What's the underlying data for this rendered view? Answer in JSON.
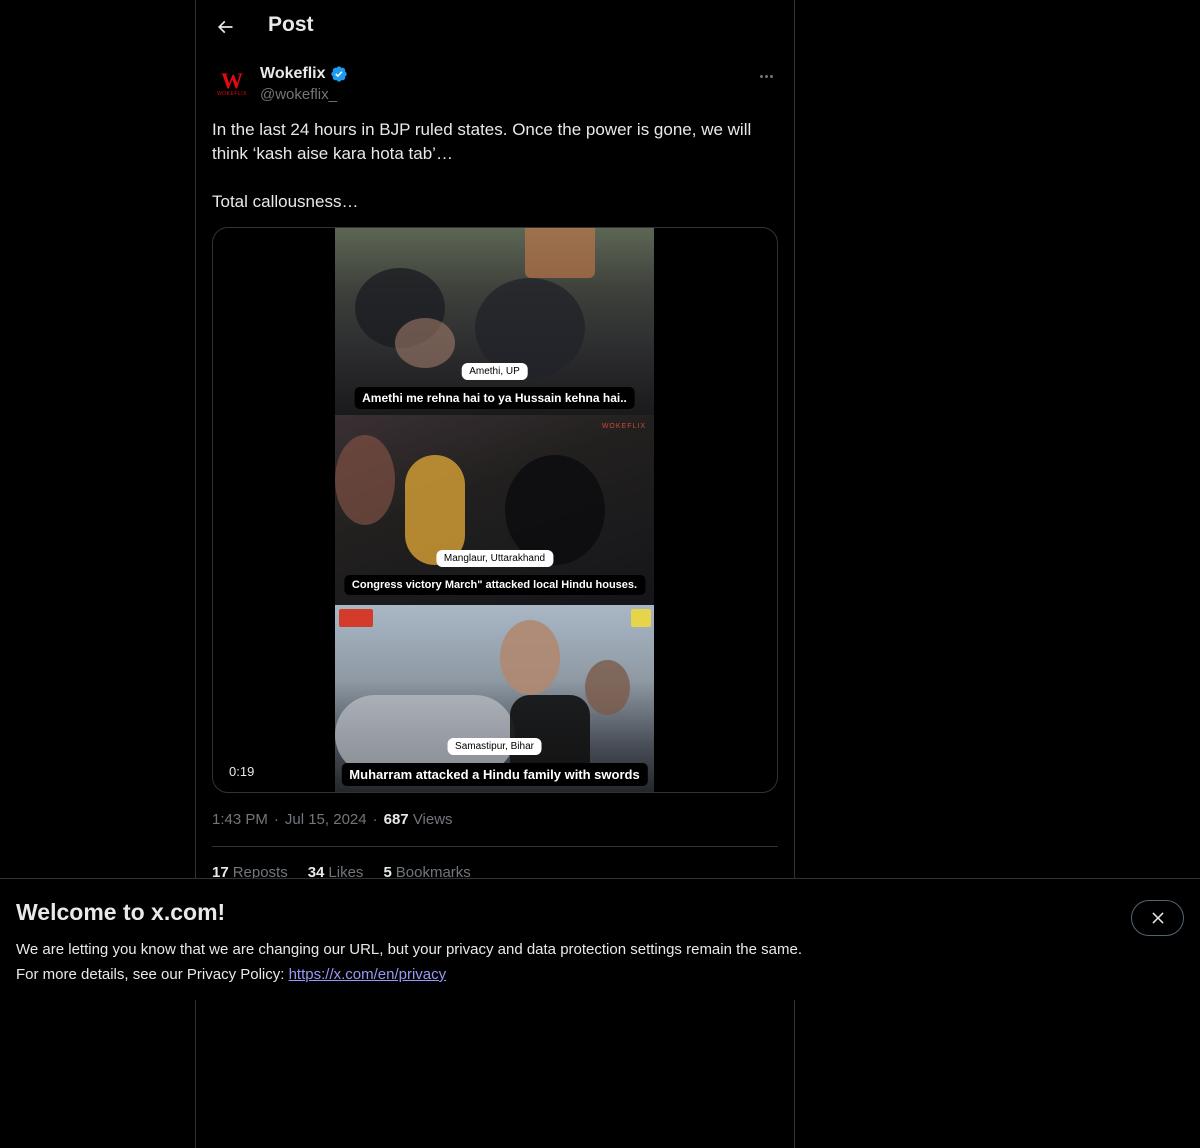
{
  "header": {
    "title": "Post"
  },
  "author": {
    "name": "Wokeflix",
    "handle": "@wokeflix_",
    "avatar_letter": "W",
    "avatar_text": "WOKEFLIX"
  },
  "post": {
    "line1": "In the last 24 hours in BJP ruled states. Once the power is gone, we will think ‘kash aise kara hota tab’…",
    "line2": "Total callousness…"
  },
  "video": {
    "duration": "0:19",
    "watermark": "WOKEFLIX",
    "panels": [
      {
        "location": "Amethi, UP",
        "caption": "Amethi me rehna hai to ya Hussain kehna hai.."
      },
      {
        "location": "Manglaur, Uttarakhand",
        "caption": "Congress victory March\" attacked local Hindu houses."
      },
      {
        "location": "Samastipur, Bihar",
        "caption": "Muharram attacked a Hindu family with swords"
      }
    ]
  },
  "meta": {
    "time": "1:43 PM",
    "date": "Jul 15, 2024",
    "views_count": "687",
    "views_label": "Views",
    "separator": "·"
  },
  "stats": {
    "reposts_count": "17",
    "reposts_label": "Reposts",
    "likes_count": "34",
    "likes_label": "Likes",
    "bookmarks_count": "5",
    "bookmarks_label": "Bookmarks"
  },
  "banner": {
    "title": "Welcome to x.com!",
    "text1": "We are letting you know that we are changing our URL, but your privacy and data protection settings remain the same.",
    "text2": "For more details, see our Privacy Policy: ",
    "link": "https://x.com/en/privacy"
  },
  "colors": {
    "background": "#000000",
    "text": "#e7e9ea",
    "secondary": "#71767b",
    "verified": "#1d9bf0",
    "link": "#9b97f5",
    "border": "#2f3336"
  },
  "icons": {
    "back": "arrow-left-icon",
    "verified": "verified-badge-icon",
    "more": "more-dots-icon",
    "close": "close-icon"
  }
}
